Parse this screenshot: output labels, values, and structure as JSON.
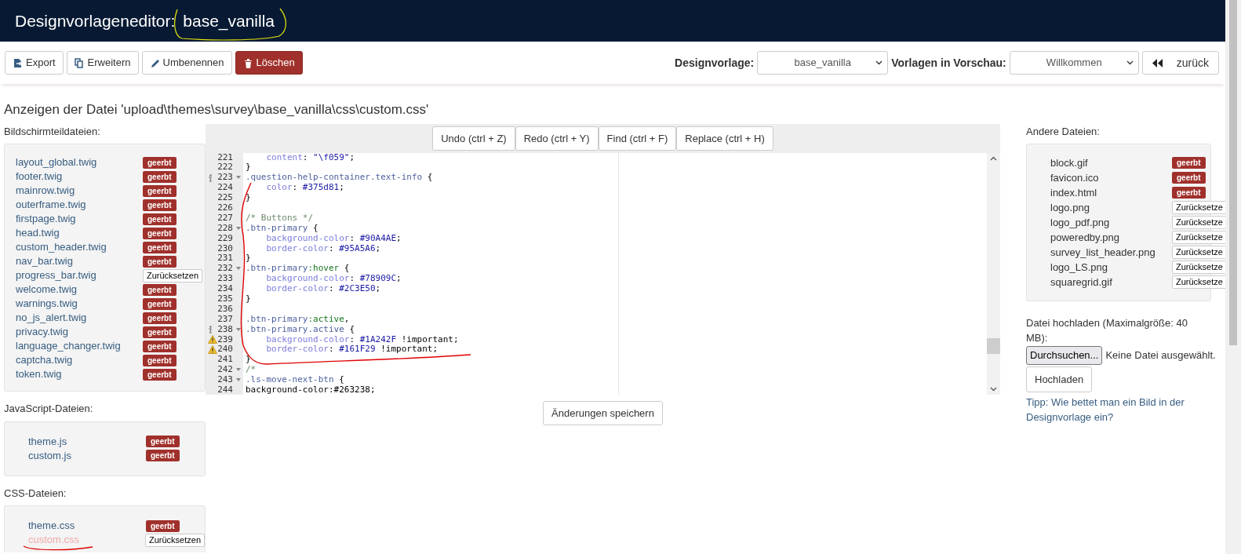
{
  "header": {
    "title": "Designvorlageneditor:",
    "theme_name": "base_vanilla"
  },
  "toolbar": {
    "buttons": [
      {
        "label": "Export",
        "kind": "export"
      },
      {
        "label": "Erweitern",
        "kind": "extend"
      },
      {
        "label": "Umbenennen",
        "kind": "rename"
      },
      {
        "label": "Löschen",
        "kind": "delete"
      }
    ],
    "template_label": "Designvorlage:",
    "template_value": "base_vanilla",
    "preview_label": "Vorlagen in Vorschau:",
    "preview_value": "Willkommen",
    "back_button": "zurück"
  },
  "file_heading": "Anzeigen der Datei 'upload\\themes\\survey\\base_vanilla\\css\\custom.css'",
  "sections": [
    {
      "title": "Bildschirmteildateien:",
      "files": [
        {
          "name": "layout_global.twig",
          "selected": false,
          "kind": "badge",
          "action": "geerbt"
        },
        {
          "name": "footer.twig",
          "selected": false,
          "kind": "badge",
          "action": "geerbt"
        },
        {
          "name": "mainrow.twig",
          "selected": false,
          "kind": "badge",
          "action": "geerbt"
        },
        {
          "name": "outerframe.twig",
          "selected": false,
          "kind": "badge",
          "action": "geerbt"
        },
        {
          "name": "firstpage.twig",
          "selected": false,
          "kind": "badge",
          "action": "geerbt"
        },
        {
          "name": "head.twig",
          "selected": false,
          "kind": "badge",
          "action": "geerbt"
        },
        {
          "name": "custom_header.twig",
          "selected": false,
          "kind": "badge",
          "action": "geerbt"
        },
        {
          "name": "nav_bar.twig",
          "selected": false,
          "kind": "badge",
          "action": "geerbt"
        },
        {
          "name": "progress_bar.twig",
          "selected": false,
          "kind": "button",
          "action": "Zurücksetzen"
        },
        {
          "name": "welcome.twig",
          "selected": false,
          "kind": "badge",
          "action": "geerbt"
        },
        {
          "name": "warnings.twig",
          "selected": false,
          "kind": "badge",
          "action": "geerbt"
        },
        {
          "name": "no_js_alert.twig",
          "selected": false,
          "kind": "badge",
          "action": "geerbt"
        },
        {
          "name": "privacy.twig",
          "selected": false,
          "kind": "badge",
          "action": "geerbt"
        },
        {
          "name": "language_changer.twig",
          "selected": false,
          "kind": "badge",
          "action": "geerbt"
        },
        {
          "name": "captcha.twig",
          "selected": false,
          "kind": "badge",
          "action": "geerbt"
        },
        {
          "name": "token.twig",
          "selected": false,
          "kind": "badge",
          "action": "geerbt"
        }
      ]
    },
    {
      "title": "JavaScript-Dateien:",
      "files": [
        {
          "name": "theme.js",
          "selected": false,
          "kind": "badge",
          "action": "geerbt"
        },
        {
          "name": "custom.js",
          "selected": false,
          "kind": "badge",
          "action": "geerbt"
        }
      ]
    },
    {
      "title": "CSS-Dateien:",
      "files": [
        {
          "name": "theme.css",
          "selected": false,
          "kind": "badge",
          "action": "geerbt"
        },
        {
          "name": "custom.css",
          "selected": true,
          "kind": "button",
          "action": "Zurücksetzen"
        }
      ]
    }
  ],
  "editor": {
    "buttons": [
      "Undo (ctrl + Z)",
      "Redo (ctrl + Y)",
      "Find (ctrl + F)",
      "Replace (ctrl + H)"
    ],
    "lines": [
      {
        "number": "221",
        "fold": false,
        "indent": true,
        "tokens": [
          {
            "kind": "prop",
            "text": "content"
          },
          {
            "kind": "punc",
            "text": ": "
          },
          {
            "kind": "val",
            "text": "\"\\f059\""
          },
          {
            "kind": "punc",
            "text": ";"
          }
        ]
      },
      {
        "number": "222",
        "fold": false,
        "indent": false,
        "tokens": [
          {
            "kind": "punc",
            "text": "}"
          }
        ]
      },
      {
        "number": "223",
        "fold": true,
        "kind": "info",
        "indent": false,
        "tokens": [
          {
            "kind": "sel",
            "text": ".question-help-container.text-info"
          },
          {
            "kind": "punc",
            "text": " {"
          }
        ]
      },
      {
        "number": "224",
        "fold": false,
        "indent": true,
        "tokens": [
          {
            "kind": "prop",
            "text": "color"
          },
          {
            "kind": "punc",
            "text": ": "
          },
          {
            "kind": "val",
            "text": "#375d81"
          },
          {
            "kind": "punc",
            "text": ";"
          }
        ]
      },
      {
        "number": "225",
        "fold": false,
        "indent": false,
        "tokens": [
          {
            "kind": "punc",
            "text": "}"
          }
        ]
      },
      {
        "number": "226",
        "fold": false
      },
      {
        "number": "227",
        "fold": false,
        "indent": false,
        "tokens": [
          {
            "kind": "com",
            "text": "/* Buttons */"
          }
        ]
      },
      {
        "number": "228",
        "fold": true,
        "indent": false,
        "tokens": [
          {
            "kind": "sel",
            "text": ".btn-primary"
          },
          {
            "kind": "punc",
            "text": " {"
          }
        ]
      },
      {
        "number": "229",
        "fold": false,
        "indent": true,
        "tokens": [
          {
            "kind": "prop",
            "text": "background-color"
          },
          {
            "kind": "punc",
            "text": ": "
          },
          {
            "kind": "val",
            "text": "#90A4AE"
          },
          {
            "kind": "punc",
            "text": ";"
          }
        ]
      },
      {
        "number": "230",
        "fold": false,
        "indent": true,
        "tokens": [
          {
            "kind": "prop",
            "text": "border-color"
          },
          {
            "kind": "punc",
            "text": ": "
          },
          {
            "kind": "val",
            "text": "#95A5A6"
          },
          {
            "kind": "punc",
            "text": ";"
          }
        ]
      },
      {
        "number": "231",
        "fold": false,
        "indent": false,
        "tokens": [
          {
            "kind": "punc",
            "text": "}"
          }
        ]
      },
      {
        "number": "232",
        "fold": true,
        "indent": false,
        "tokens": [
          {
            "kind": "sel",
            "text": ".btn-primary"
          },
          {
            "kind": "pseudo",
            "text": ":hover"
          },
          {
            "kind": "punc",
            "text": " {"
          }
        ]
      },
      {
        "number": "233",
        "fold": false,
        "indent": true,
        "tokens": [
          {
            "kind": "prop",
            "text": "background-color"
          },
          {
            "kind": "punc",
            "text": ": "
          },
          {
            "kind": "val",
            "text": "#78909C"
          },
          {
            "kind": "punc",
            "text": ";"
          }
        ]
      },
      {
        "number": "234",
        "fold": false,
        "indent": true,
        "tokens": [
          {
            "kind": "prop",
            "text": "border-color"
          },
          {
            "kind": "punc",
            "text": ": "
          },
          {
            "kind": "val",
            "text": "#2C3E50"
          },
          {
            "kind": "punc",
            "text": ";"
          }
        ]
      },
      {
        "number": "235",
        "fold": false,
        "indent": false,
        "tokens": [
          {
            "kind": "punc",
            "text": "}"
          }
        ]
      },
      {
        "number": "236",
        "fold": false
      },
      {
        "number": "237",
        "fold": false,
        "indent": false,
        "tokens": [
          {
            "kind": "sel",
            "text": ".btn-primary"
          },
          {
            "kind": "pseudo",
            "text": ":active"
          },
          {
            "kind": "punc",
            "text": ","
          }
        ]
      },
      {
        "number": "238",
        "fold": true,
        "kind": "info",
        "indent": false,
        "tokens": [
          {
            "kind": "sel",
            "text": ".btn-primary.active"
          },
          {
            "kind": "punc",
            "text": " {"
          }
        ]
      },
      {
        "number": "239",
        "fold": false,
        "kind": "warning",
        "indent": true,
        "tokens": [
          {
            "kind": "prop",
            "text": "background-color"
          },
          {
            "kind": "punc",
            "text": ": "
          },
          {
            "kind": "val",
            "text": "#1A242F"
          },
          {
            "kind": "punc",
            "text": " !important;"
          }
        ]
      },
      {
        "number": "240",
        "fold": false,
        "kind": "warning",
        "indent": true,
        "tokens": [
          {
            "kind": "prop",
            "text": "border-color"
          },
          {
            "kind": "punc",
            "text": ": "
          },
          {
            "kind": "val",
            "text": "#161F29"
          },
          {
            "kind": "punc",
            "text": " !important;"
          }
        ]
      },
      {
        "number": "241",
        "fold": false,
        "indent": false,
        "tokens": [
          {
            "kind": "punc",
            "text": "}"
          }
        ]
      },
      {
        "number": "242",
        "fold": true,
        "indent": false,
        "tokens": [
          {
            "kind": "com",
            "text": "/*"
          }
        ]
      },
      {
        "number": "243",
        "fold": true,
        "indent": false,
        "tokens": [
          {
            "kind": "sel",
            "text": ".ls-move-next-btn"
          },
          {
            "kind": "punc",
            "text": " {"
          }
        ]
      },
      {
        "number": "244",
        "fold": false,
        "indent": false,
        "tokens": [
          {
            "kind": "punc",
            "text": "background-color:#263238;"
          }
        ]
      }
    ]
  },
  "save_button": "Änderungen speichern",
  "other_files": {
    "title": "Andere Dateien:",
    "files": [
      {
        "name": "block.gif",
        "kind": "badge",
        "action": "geerbt"
      },
      {
        "name": "favicon.ico",
        "kind": "badge",
        "action": "geerbt"
      },
      {
        "name": "index.html",
        "kind": "badge",
        "action": "geerbt"
      },
      {
        "name": "logo.png",
        "kind": "button",
        "action": "Zurücksetze"
      },
      {
        "name": "logo_pdf.png",
        "kind": "button",
        "action": "Zurücksetze"
      },
      {
        "name": "poweredby.png",
        "kind": "button",
        "action": "Zurücksetze"
      },
      {
        "name": "survey_list_header.png",
        "kind": "button",
        "action": "Zurücksetze"
      },
      {
        "name": "logo_LS.png",
        "kind": "button",
        "action": "Zurücksetze"
      },
      {
        "name": "squaregrid.gif",
        "kind": "button",
        "action": "Zurücksetze"
      }
    ]
  },
  "upload": {
    "label": "Datei hochladen (Maximalgröße: 40 MB):",
    "browse_button": "Durchsuchen...",
    "no_file": "Keine Datei ausgewählt.",
    "upload_button": "Hochladen",
    "tip_link": "Tipp: Wie bettet man ein Bild in der Designvorlage ein?"
  }
}
